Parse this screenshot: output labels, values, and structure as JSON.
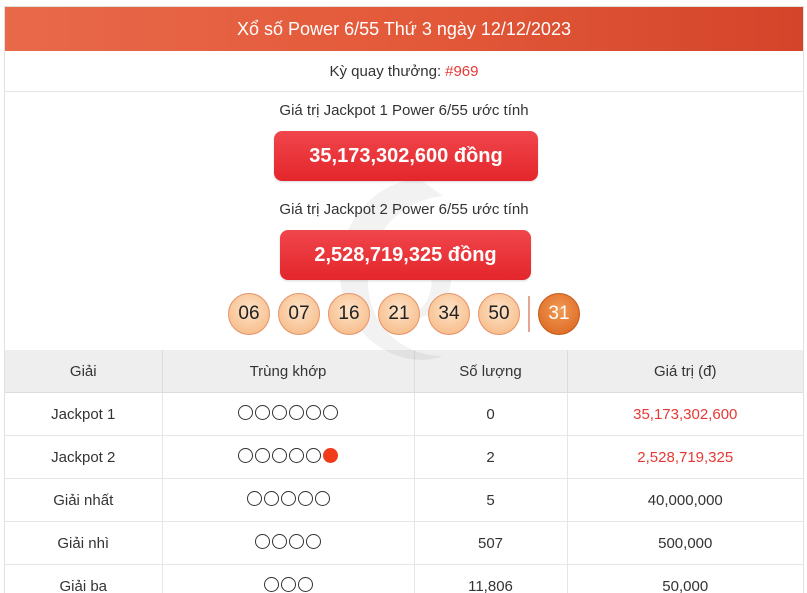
{
  "header": {
    "title": "Xổ số Power 6/55 Thứ 3 ngày 12/12/2023"
  },
  "draw": {
    "label": "Kỳ quay thưởng:",
    "number": "#969"
  },
  "jackpot1": {
    "label": "Giá trị Jackpot 1 Power 6/55 ước tính",
    "value": "35,173,302,600 đồng"
  },
  "jackpot2": {
    "label": "Giá trị Jackpot 2 Power 6/55 ước tính",
    "value": "2,528,719,325 đồng"
  },
  "balls": [
    "06",
    "07",
    "16",
    "21",
    "34",
    "50"
  ],
  "power_ball": "31",
  "colors": {
    "header": "#e35a3a",
    "accent_red": "#e53935",
    "ball": "#f8c293",
    "power_ball": "#e0722c"
  },
  "table": {
    "headers": {
      "prize": "Giải",
      "match": "Trùng khớp",
      "count": "Số lượng",
      "value": "Giá trị (đ)"
    },
    "rows": [
      {
        "prize": "Jackpot 1",
        "circles": 6,
        "power": false,
        "count": "0",
        "value": "35,173,302,600",
        "highlight": true
      },
      {
        "prize": "Jackpot 2",
        "circles": 5,
        "power": true,
        "count": "2",
        "value": "2,528,719,325",
        "highlight": true
      },
      {
        "prize": "Giải nhất",
        "circles": 5,
        "power": false,
        "count": "5",
        "value": "40,000,000",
        "highlight": false
      },
      {
        "prize": "Giải nhì",
        "circles": 4,
        "power": false,
        "count": "507",
        "value": "500,000",
        "highlight": false
      },
      {
        "prize": "Giải ba",
        "circles": 3,
        "power": false,
        "count": "11,806",
        "value": "50,000",
        "highlight": false
      }
    ]
  }
}
